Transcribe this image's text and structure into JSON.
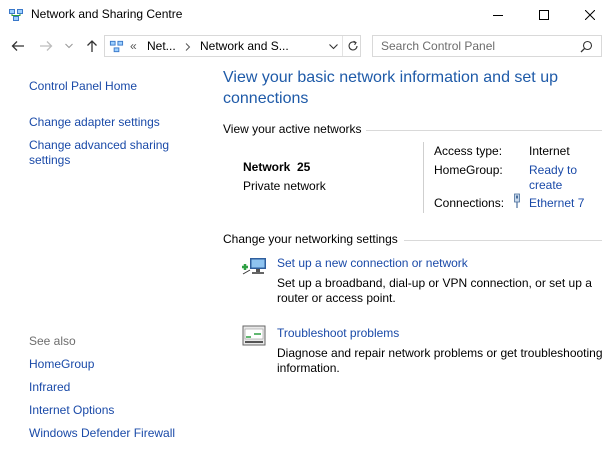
{
  "window": {
    "title": "Network and Sharing Centre"
  },
  "nav": {
    "address_segments": [
      "Net...",
      "Network and S..."
    ],
    "address_overflow": "«",
    "search_placeholder": "Search Control Panel"
  },
  "sidebar": {
    "links": [
      {
        "label": "Control Panel Home"
      },
      {
        "label": "Change adapter settings"
      },
      {
        "label": "Change advanced sharing settings"
      }
    ],
    "see_also_heading": "See also",
    "see_also": [
      {
        "label": "HomeGroup"
      },
      {
        "label": "Infrared"
      },
      {
        "label": "Internet Options"
      },
      {
        "label": "Windows Defender Firewall"
      }
    ]
  },
  "main": {
    "title": "View your basic network information and set up connections",
    "active_networks_heading": "View your active networks",
    "network": {
      "name": "Network  25",
      "category": "Private network",
      "access_type_label": "Access type:",
      "access_type_value": "Internet",
      "homegroup_label": "HomeGroup:",
      "homegroup_value": "Ready to create",
      "connections_label": "Connections:",
      "connections_value": "Ethernet 7"
    },
    "change_settings_heading": "Change your networking settings",
    "tasks": [
      {
        "title": "Set up a new connection or network",
        "description": "Set up a broadband, dial-up or VPN connection, or set up a router or access point."
      },
      {
        "title": "Troubleshoot problems",
        "description": "Diagnose and repair network problems or get troubleshooting information."
      }
    ]
  }
}
